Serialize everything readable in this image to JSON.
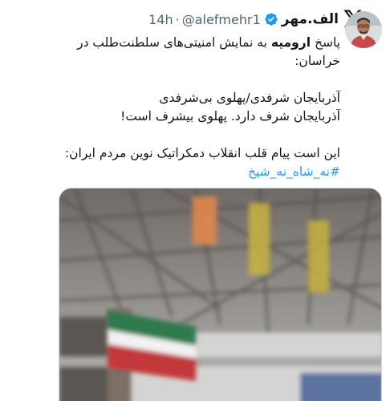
{
  "tweet": {
    "display_name": "الف.مهر",
    "handle": "@alefmehr1",
    "separator": "·",
    "time": "14h",
    "text": {
      "line1_prefix": "پاسخ ",
      "line1_bold": "ارومیه",
      "line1_suffix": " به نمایش امنیتی‌های سلطنت‌طلب در",
      "line2": "خراسان:",
      "line3": "آذربایجان شرفدی/پهلوی بی‌شرفدی",
      "line4": "آذربایجان شرف دارد. پهلوی بیشرف است!",
      "line5": "این است پیام قلب انقلاب دمکراتیک نوین مردم ایران:",
      "hashtag": "#نه_شاه_نه_شیخ"
    }
  },
  "icons": {
    "logo": "x-logo-icon",
    "verified": "verified-badge-icon"
  },
  "colors": {
    "text": "#0f1419",
    "secondary": "#536471",
    "link": "#1d9bf0",
    "verified": "#1d9bf0"
  }
}
